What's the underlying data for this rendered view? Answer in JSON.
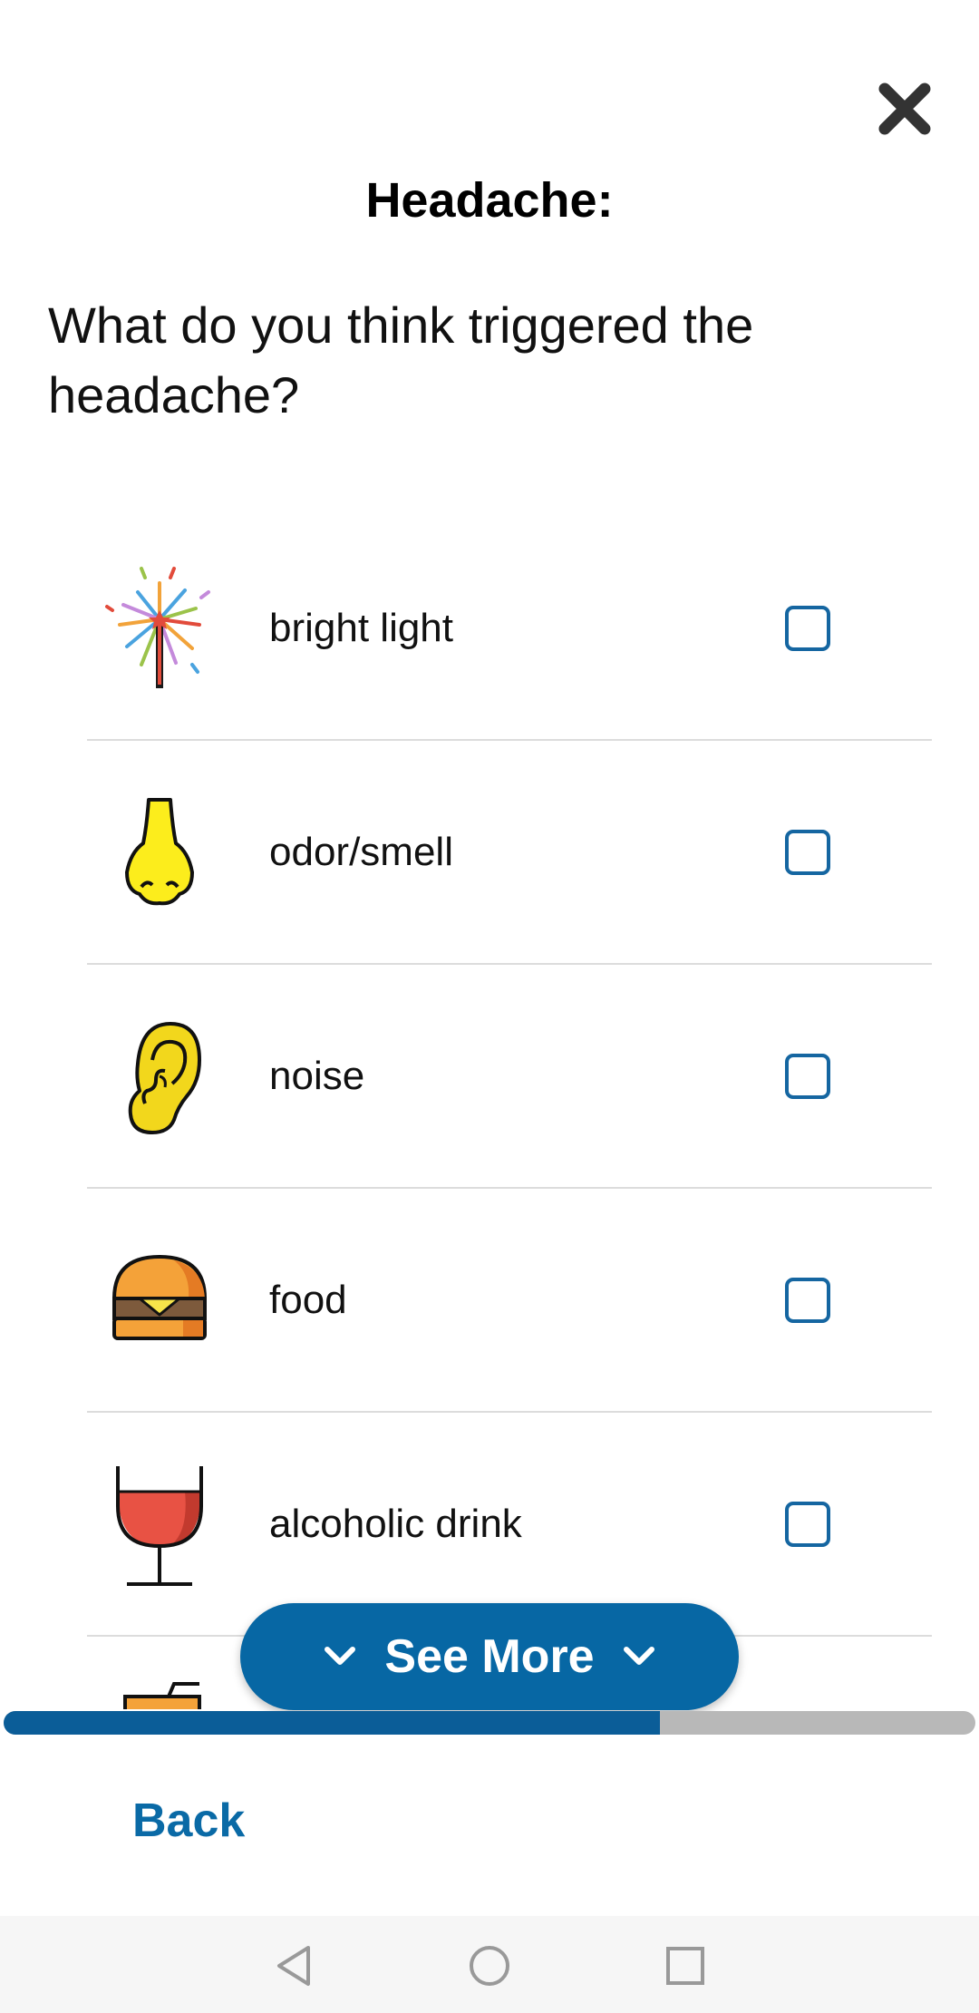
{
  "header": {
    "title": "Headache:",
    "question": "What do you think triggered the headache?",
    "close_icon": "close-icon"
  },
  "triggers": [
    {
      "label": "bright light",
      "icon": "sparkler-icon",
      "checked": false
    },
    {
      "label": "odor/smell",
      "icon": "nose-icon",
      "checked": false
    },
    {
      "label": "noise",
      "icon": "ear-icon",
      "checked": false
    },
    {
      "label": "food",
      "icon": "hamburger-icon",
      "checked": false
    },
    {
      "label": "alcoholic drink",
      "icon": "wine-glass-icon",
      "checked": false
    }
  ],
  "see_more": {
    "label": "See More",
    "icon": "chevron-down-icon"
  },
  "progress": {
    "fraction": 0.675,
    "fill_color": "#0b5d98",
    "track_color": "#b8b8b8"
  },
  "footer": {
    "back_label": "Back"
  },
  "nav": {
    "icons": [
      "back-triangle-icon",
      "home-circle-icon",
      "recents-square-icon"
    ]
  },
  "colors": {
    "accent": "#0767a4",
    "checkbox_border": "#1566a1",
    "link": "#0a6aa6"
  }
}
